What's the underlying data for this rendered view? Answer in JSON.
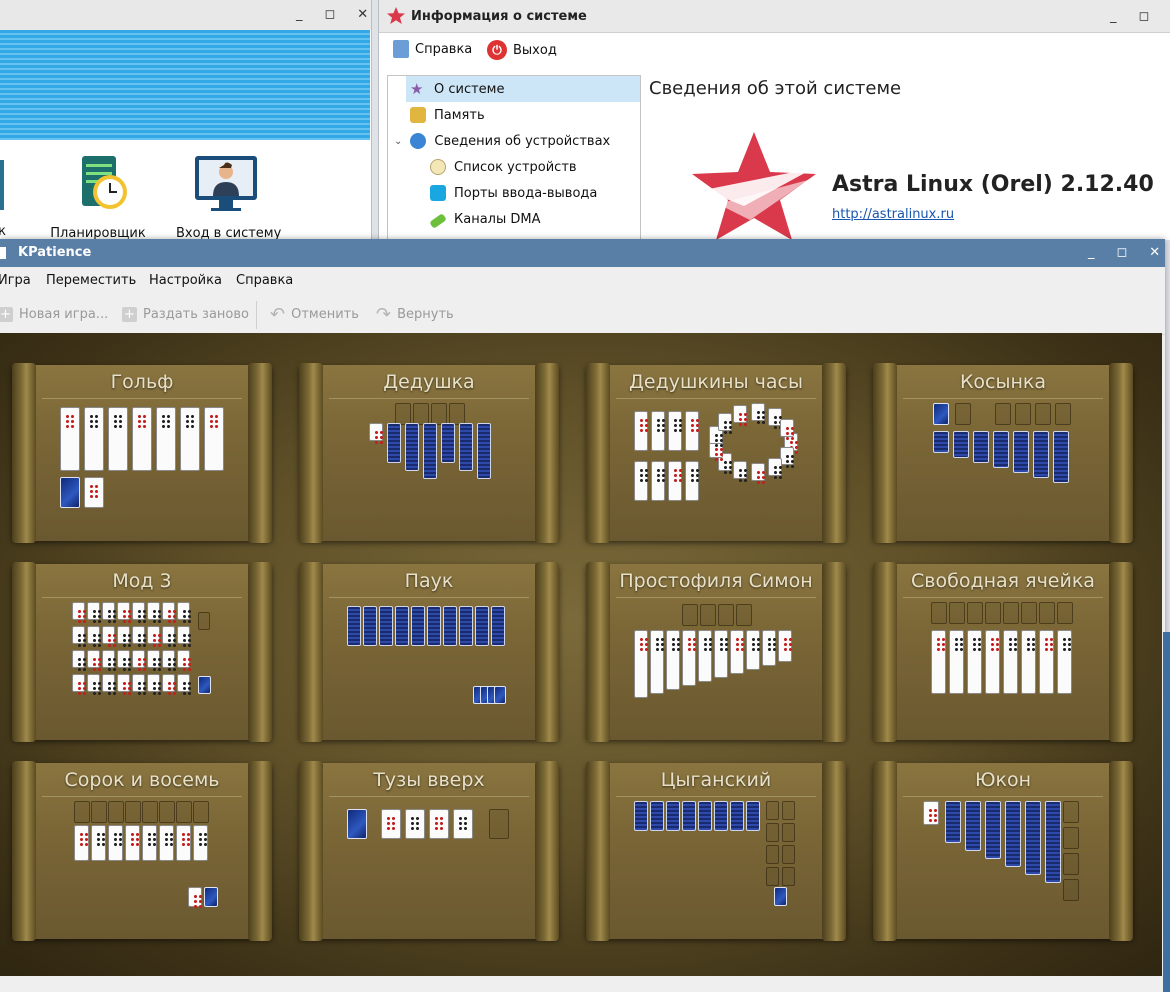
{
  "background_left": {
    "apps": [
      {
        "label": "к",
        "icon": "partial-icon"
      },
      {
        "label": "Планировщик",
        "icon": "scheduler-icon"
      },
      {
        "label": "Вход в систему",
        "icon": "login-icon"
      }
    ]
  },
  "sysinfo": {
    "title": "Информация о системе",
    "menu": {
      "help": "Справка",
      "exit": "Выход"
    },
    "tree": [
      {
        "label": "О системе",
        "icon": "star-icon",
        "selected": true
      },
      {
        "label": "Память",
        "icon": "memory-icon"
      },
      {
        "label": "Сведения об устройствах",
        "icon": "info-icon",
        "expanded": true
      },
      {
        "label": "Список устройств",
        "icon": "device-list-icon"
      },
      {
        "label": "Порты ввода-вывода",
        "icon": "monitor-icon"
      },
      {
        "label": "Каналы DMA",
        "icon": "dma-icon"
      }
    ],
    "heading": "Сведения об этой системе",
    "os_name": "Astra Linux (Orel) 2.12.40",
    "os_link": "http://astralinux.ru",
    "colors": {
      "accent": "#d9394a"
    }
  },
  "kpatience": {
    "title": "KPatience",
    "menu": [
      "Игра",
      "Переместить",
      "Настройка",
      "Справка"
    ],
    "toolbar": {
      "new_game": "Новая игра...",
      "redeal": "Раздать заново",
      "undo": "Отменить",
      "redo": "Вернуть"
    },
    "games": [
      "Гольф",
      "Дедушка",
      "Дедушкины часы",
      "Косынка",
      "Мод 3",
      "Паук",
      "Простофиля Симон",
      "Свободная ячейка",
      "Сорок и восемь",
      "Тузы вверх",
      "Цыганский",
      "Юкон"
    ],
    "colors": {
      "titlebar": "#5a7fa6",
      "felt": "#6b5b2e"
    }
  }
}
